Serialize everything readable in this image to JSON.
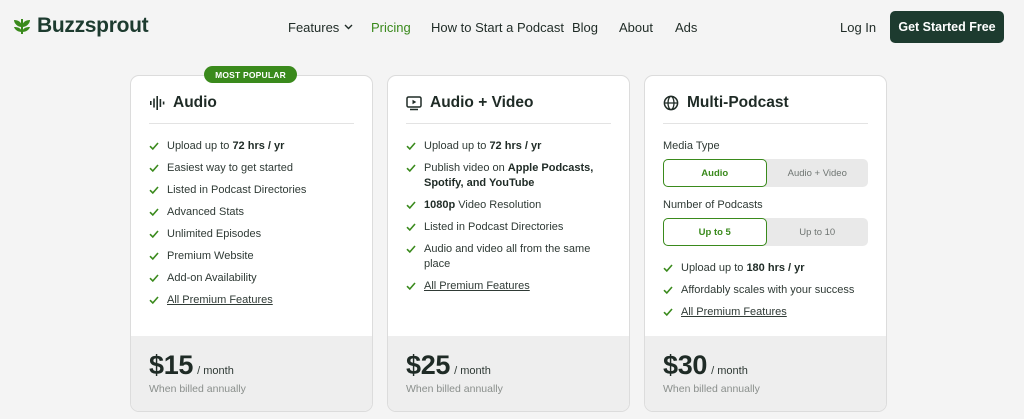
{
  "brand": {
    "name": "Buzzsprout",
    "icon": "leaf-logo-icon",
    "color": "#3a8a1c"
  },
  "nav": {
    "features": "Features",
    "pricing": "Pricing",
    "howto": "How to Start a Podcast",
    "blog": "Blog",
    "about": "About",
    "ads": "Ads",
    "login": "Log In",
    "cta": "Get Started Free"
  },
  "badge": "MOST POPULAR",
  "plans": {
    "audio": {
      "title": "Audio",
      "icon": "soundwave-icon",
      "features": [
        {
          "pre": "Upload up to ",
          "bold": "72 hrs / yr",
          "post": ""
        },
        {
          "pre": "Easiest way to get started",
          "bold": "",
          "post": ""
        },
        {
          "pre": "Listed in Podcast Directories",
          "bold": "",
          "post": ""
        },
        {
          "pre": "Advanced Stats",
          "bold": "",
          "post": ""
        },
        {
          "pre": "Unlimited Episodes",
          "bold": "",
          "post": ""
        },
        {
          "pre": "Premium Website",
          "bold": "",
          "post": ""
        },
        {
          "pre": "Add-on Availability",
          "bold": "",
          "post": ""
        }
      ],
      "link": "All Premium Features",
      "price": "$15",
      "per": "/ month",
      "billed": "When billed annually"
    },
    "video": {
      "title": "Audio + Video",
      "icon": "video-play-icon",
      "features": [
        {
          "pre": "Upload up to ",
          "bold": "72 hrs / yr",
          "post": ""
        },
        {
          "pre": "Publish video on ",
          "bold": "Apple Podcasts, Spotify, and YouTube",
          "post": ""
        },
        {
          "pre": "",
          "bold": "1080p",
          "post": " Video Resolution"
        },
        {
          "pre": "Listed in Podcast Directories",
          "bold": "",
          "post": ""
        },
        {
          "pre": "Audio and video all from the same place",
          "bold": "",
          "post": ""
        }
      ],
      "link": "All Premium Features",
      "price": "$25",
      "per": "/ month",
      "billed": "When billed annually"
    },
    "multi": {
      "title": "Multi-Podcast",
      "icon": "globe-icon",
      "media_label": "Media Type",
      "media_options": [
        "Audio",
        "Audio + Video"
      ],
      "media_selected": "Audio",
      "count_label": "Number of Podcasts",
      "count_options": [
        "Up to 5",
        "Up to 10"
      ],
      "count_selected": "Up to 5",
      "features": [
        {
          "pre": "Upload up to ",
          "bold": "180 hrs / yr",
          "post": ""
        },
        {
          "pre": "Affordably scales with your success",
          "bold": "",
          "post": ""
        }
      ],
      "link": "All Premium Features",
      "price": "$30",
      "per": "/ month",
      "billed": "When billed annually"
    }
  }
}
